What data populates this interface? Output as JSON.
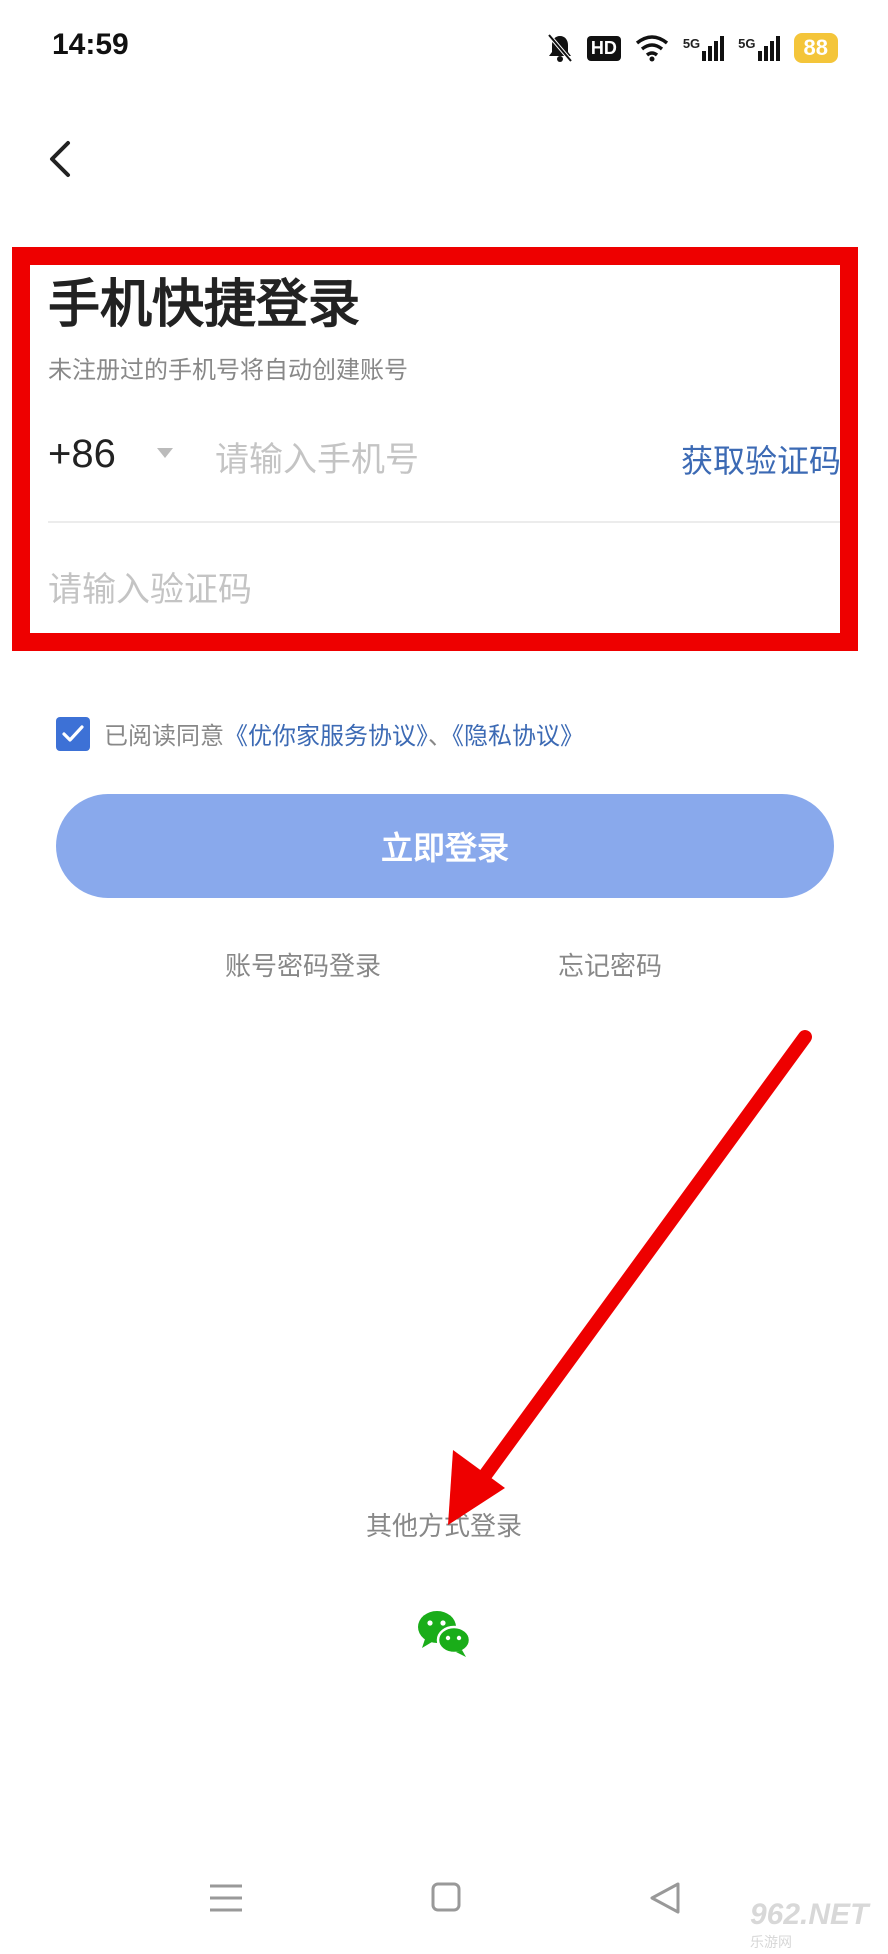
{
  "status_bar": {
    "time": "14:59",
    "hd_label": "HD",
    "sim1_label": "5G",
    "sim2_label": "5G",
    "battery": "88",
    "icons": [
      "bell-muted-icon",
      "hd-icon",
      "wifi-icon",
      "signal-5g-icon",
      "signal-5g-icon",
      "battery-icon"
    ]
  },
  "header": {
    "back_icon": "chevron-left-icon"
  },
  "login_form": {
    "title": "手机快捷登录",
    "subtitle": "未注册过的手机号将自动创建账号",
    "country_code": "+86",
    "phone_placeholder": "请输入手机号",
    "get_code_label": "获取验证码",
    "code_placeholder": "请输入验证码"
  },
  "agreement": {
    "checked": true,
    "prefix": "已阅读同意",
    "service_link": "《优你家服务协议》",
    "separator": "、",
    "privacy_link": "《隐私协议》"
  },
  "actions": {
    "login_label": "立即登录",
    "password_login": "账号密码登录",
    "forgot_password": "忘记密码"
  },
  "other_login": {
    "label": "其他方式登录",
    "wechat_icon": "wechat-icon"
  },
  "nav_bar": {
    "icons": [
      "menu-icon",
      "home-square-icon",
      "back-triangle-icon"
    ]
  },
  "watermark": {
    "main": "962.NET",
    "sub": "乐游网"
  },
  "colors": {
    "highlight": "#ee0000",
    "link": "#3c6ab4",
    "login_button": "#89a9ec",
    "checkbox": "#3d71d6",
    "wechat": "#1aad19"
  }
}
